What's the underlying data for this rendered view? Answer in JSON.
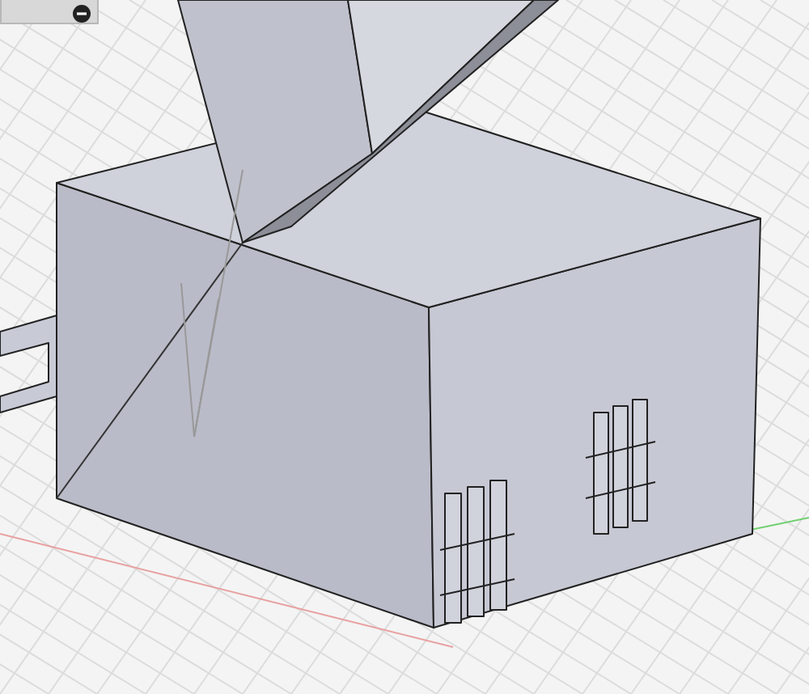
{
  "panel": {
    "expanded": true
  }
}
